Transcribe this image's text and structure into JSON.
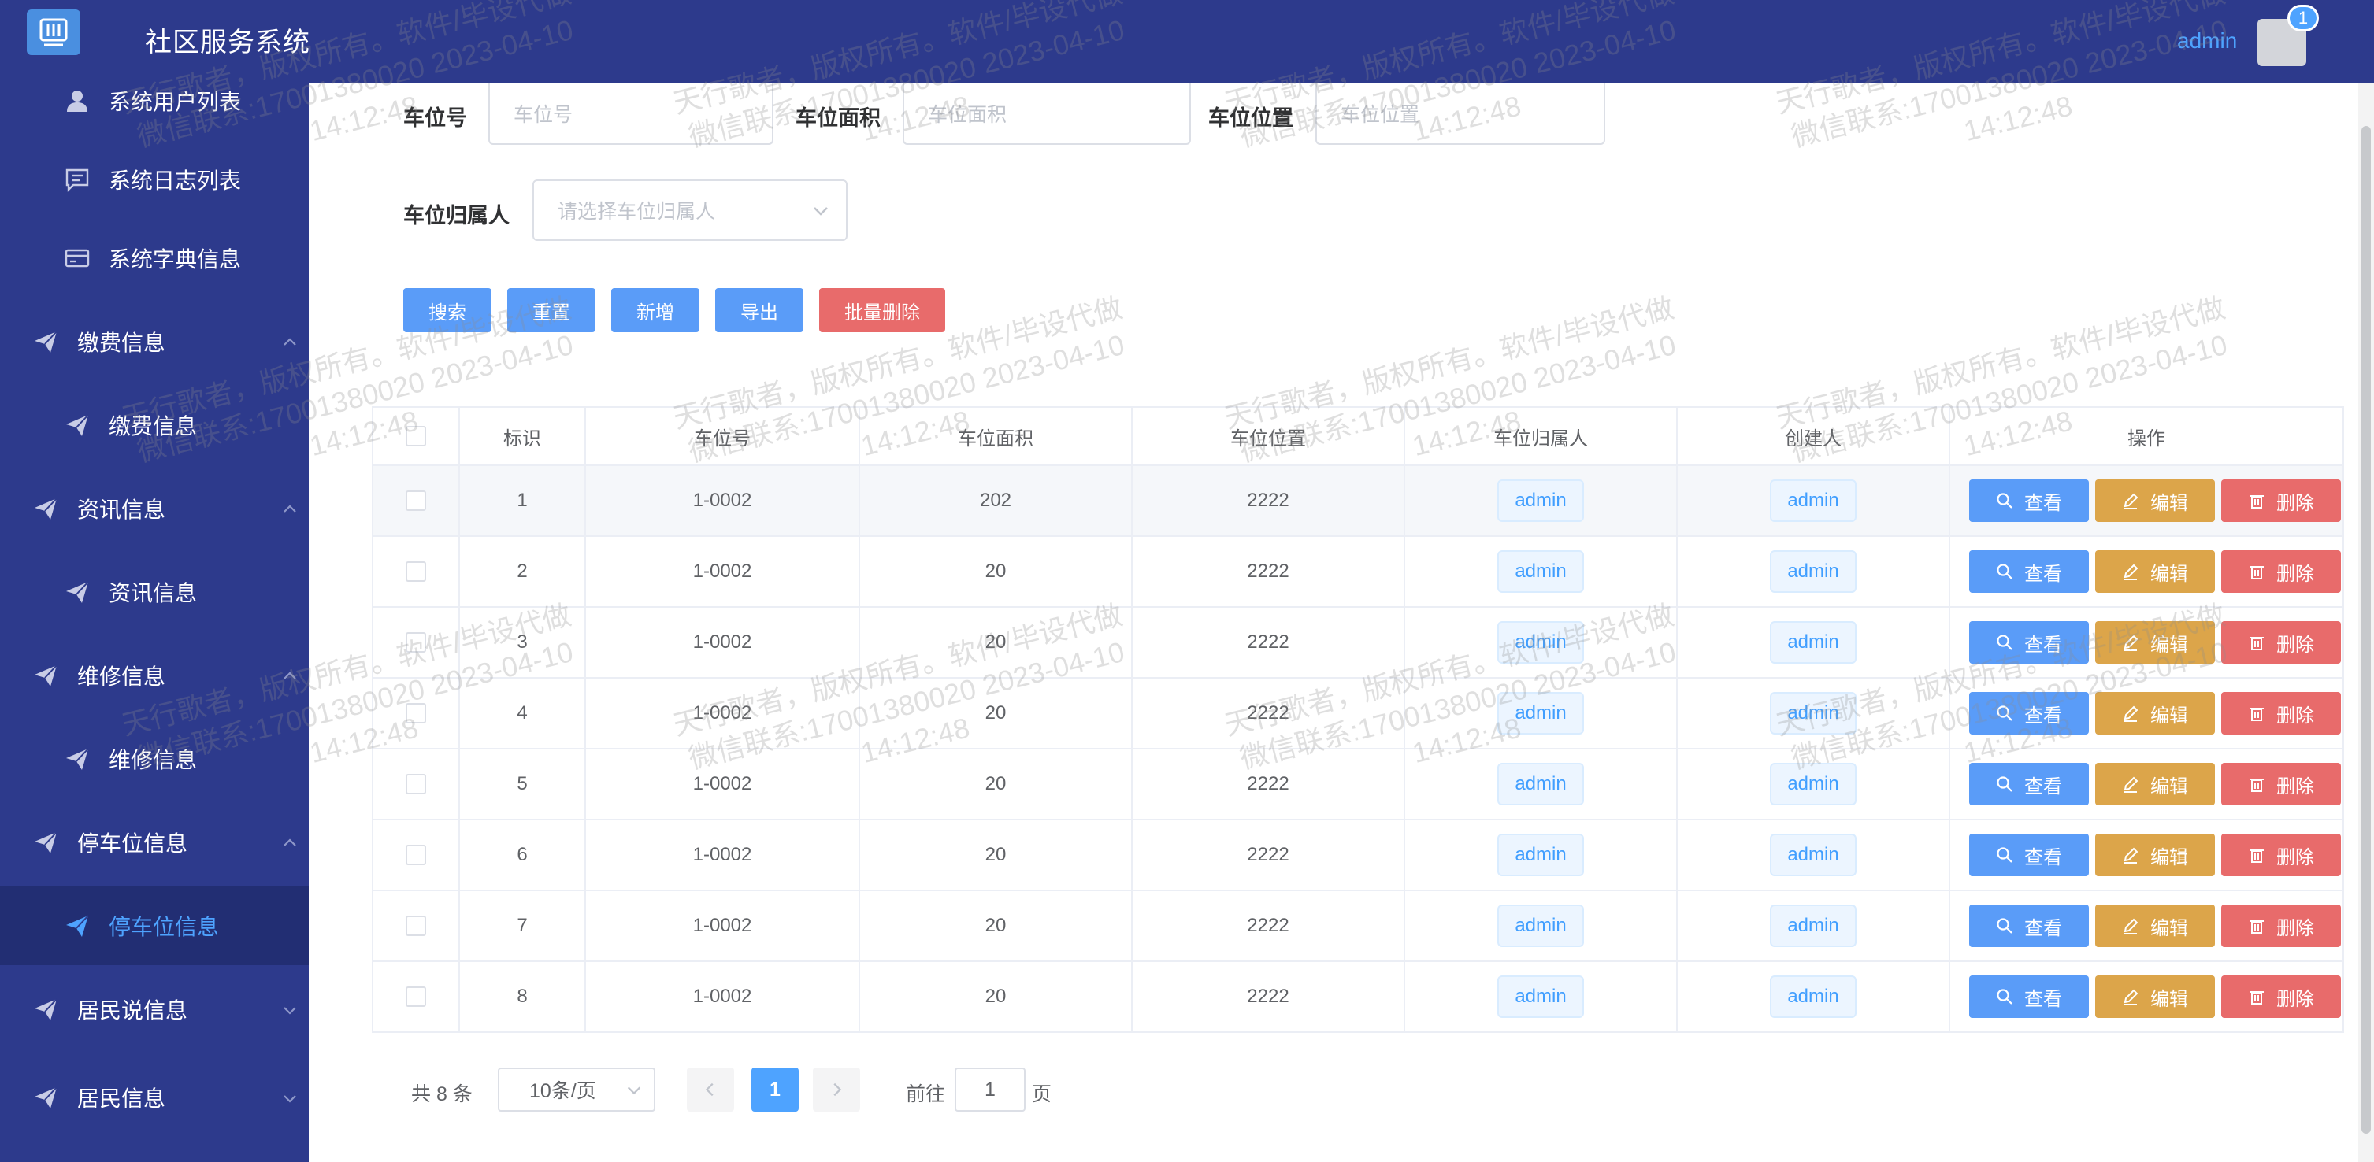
{
  "header": {
    "title": "社区服务系统",
    "user": "admin",
    "badge": "1"
  },
  "sidebar": {
    "items": [
      {
        "label": "系统用户列表",
        "icon": "user-icon",
        "kind": "sub"
      },
      {
        "label": "系统日志列表",
        "icon": "message-icon",
        "kind": "sub"
      },
      {
        "label": "系统字典信息",
        "icon": "credit-card-icon",
        "kind": "sub"
      },
      {
        "label": "缴费信息",
        "icon": "send-icon",
        "kind": "group",
        "expanded": true
      },
      {
        "label": "缴费信息",
        "icon": "send-icon",
        "kind": "sub"
      },
      {
        "label": "资讯信息",
        "icon": "send-icon",
        "kind": "group",
        "expanded": true
      },
      {
        "label": "资讯信息",
        "icon": "send-icon",
        "kind": "sub"
      },
      {
        "label": "维修信息",
        "icon": "send-icon",
        "kind": "group",
        "expanded": true
      },
      {
        "label": "维修信息",
        "icon": "send-icon",
        "kind": "sub"
      },
      {
        "label": "停车位信息",
        "icon": "send-icon",
        "kind": "group",
        "expanded": true
      },
      {
        "label": "停车位信息",
        "icon": "send-icon",
        "kind": "sub",
        "active": true
      },
      {
        "label": "居民说信息",
        "icon": "send-icon",
        "kind": "group",
        "expanded": false
      },
      {
        "label": "居民信息",
        "icon": "send-icon",
        "kind": "group",
        "expanded": false
      }
    ]
  },
  "search": {
    "parking_no_label": "车位号",
    "parking_no_placeholder": "车位号",
    "area_label": "车位面积",
    "area_placeholder": "车位面积",
    "location_label": "车位位置",
    "location_placeholder": "车位位置",
    "owner_label": "车位归属人",
    "owner_placeholder": "请选择车位归属人"
  },
  "toolbar": {
    "search": "搜索",
    "reset": "重置",
    "add": "新增",
    "export": "导出",
    "batch_delete": "批量删除"
  },
  "table": {
    "columns": [
      "标识",
      "车位号",
      "车位面积",
      "车位位置",
      "车位归属人",
      "创建人",
      "操作"
    ],
    "rows": [
      {
        "id": "1",
        "no": "1-0002",
        "area": "202",
        "loc": "2222",
        "owner": "admin",
        "creator": "admin"
      },
      {
        "id": "2",
        "no": "1-0002",
        "area": "20",
        "loc": "2222",
        "owner": "admin",
        "creator": "admin"
      },
      {
        "id": "3",
        "no": "1-0002",
        "area": "20",
        "loc": "2222",
        "owner": "admin",
        "creator": "admin"
      },
      {
        "id": "4",
        "no": "1-0002",
        "area": "20",
        "loc": "2222",
        "owner": "admin",
        "creator": "admin"
      },
      {
        "id": "5",
        "no": "1-0002",
        "area": "20",
        "loc": "2222",
        "owner": "admin",
        "creator": "admin"
      },
      {
        "id": "6",
        "no": "1-0002",
        "area": "20",
        "loc": "2222",
        "owner": "admin",
        "creator": "admin"
      },
      {
        "id": "7",
        "no": "1-0002",
        "area": "20",
        "loc": "2222",
        "owner": "admin",
        "creator": "admin"
      },
      {
        "id": "8",
        "no": "1-0002",
        "area": "20",
        "loc": "2222",
        "owner": "admin",
        "creator": "admin"
      }
    ],
    "actions": {
      "view": "查看",
      "edit": "编辑",
      "delete": "删除"
    }
  },
  "pagination": {
    "total": "共 8 条",
    "page_size": "10条/页",
    "current": "1",
    "goto_prefix": "前往",
    "goto_value": "1",
    "goto_suffix": "页"
  },
  "watermark": {
    "line1": "天行歌者，版权所有。软件/毕设代做",
    "line2": "微信联系:17001380020 2023-04-10",
    "line3": "14:12:48"
  },
  "colors": {
    "sidebar_bg": "#2d3a8c",
    "active_bg": "#222e73",
    "accent": "#4ea3ff",
    "primary_btn": "#5a9cf8",
    "edit_btn": "#dca54a",
    "danger_btn": "#e86b6b"
  }
}
